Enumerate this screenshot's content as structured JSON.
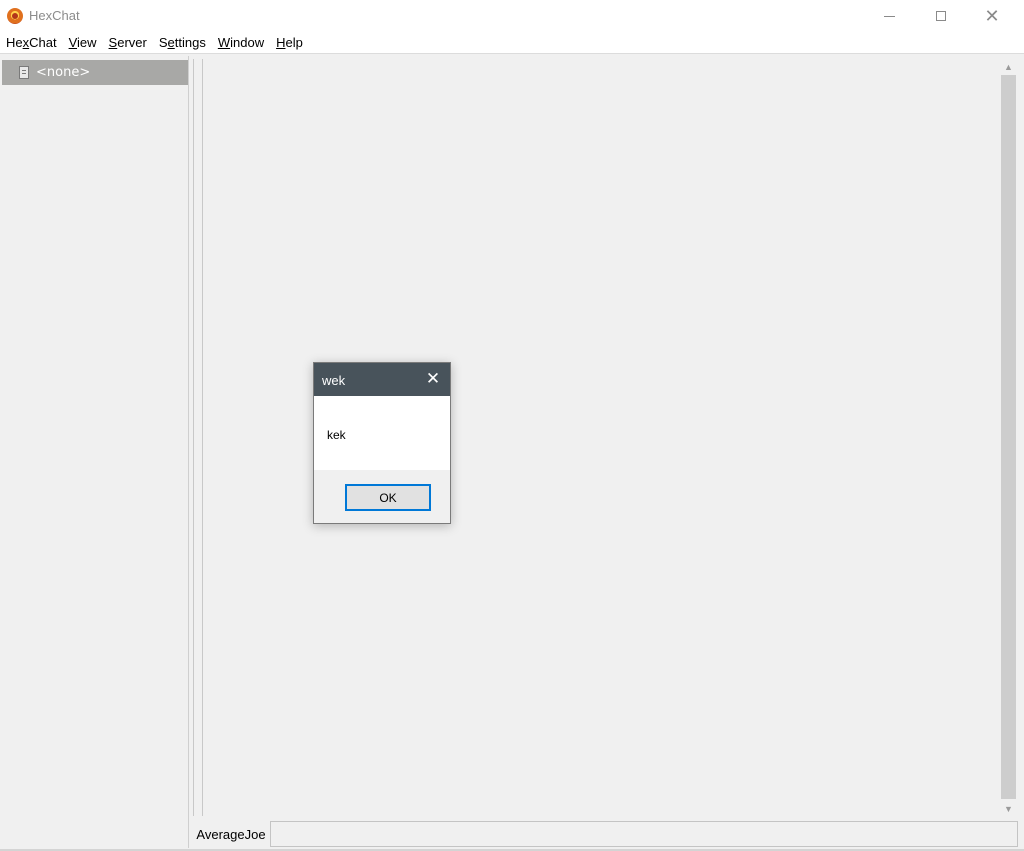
{
  "window": {
    "title": "HexChat"
  },
  "menu": {
    "items": [
      {
        "pre": "He",
        "accel": "x",
        "post": "Chat"
      },
      {
        "pre": "",
        "accel": "V",
        "post": "iew"
      },
      {
        "pre": "",
        "accel": "S",
        "post": "erver"
      },
      {
        "pre": "S",
        "accel": "e",
        "post": "ttings"
      },
      {
        "pre": "",
        "accel": "W",
        "post": "indow"
      },
      {
        "pre": "",
        "accel": "H",
        "post": "elp"
      }
    ]
  },
  "tree": {
    "items": [
      {
        "label": "<none>",
        "icon": "server-icon"
      }
    ]
  },
  "input": {
    "nick": "AverageJoe",
    "value": ""
  },
  "dialog": {
    "title": "wek",
    "message": "kek",
    "ok_label": "OK",
    "accent_color": "#0078d7",
    "titlebar_color": "#48535b"
  }
}
